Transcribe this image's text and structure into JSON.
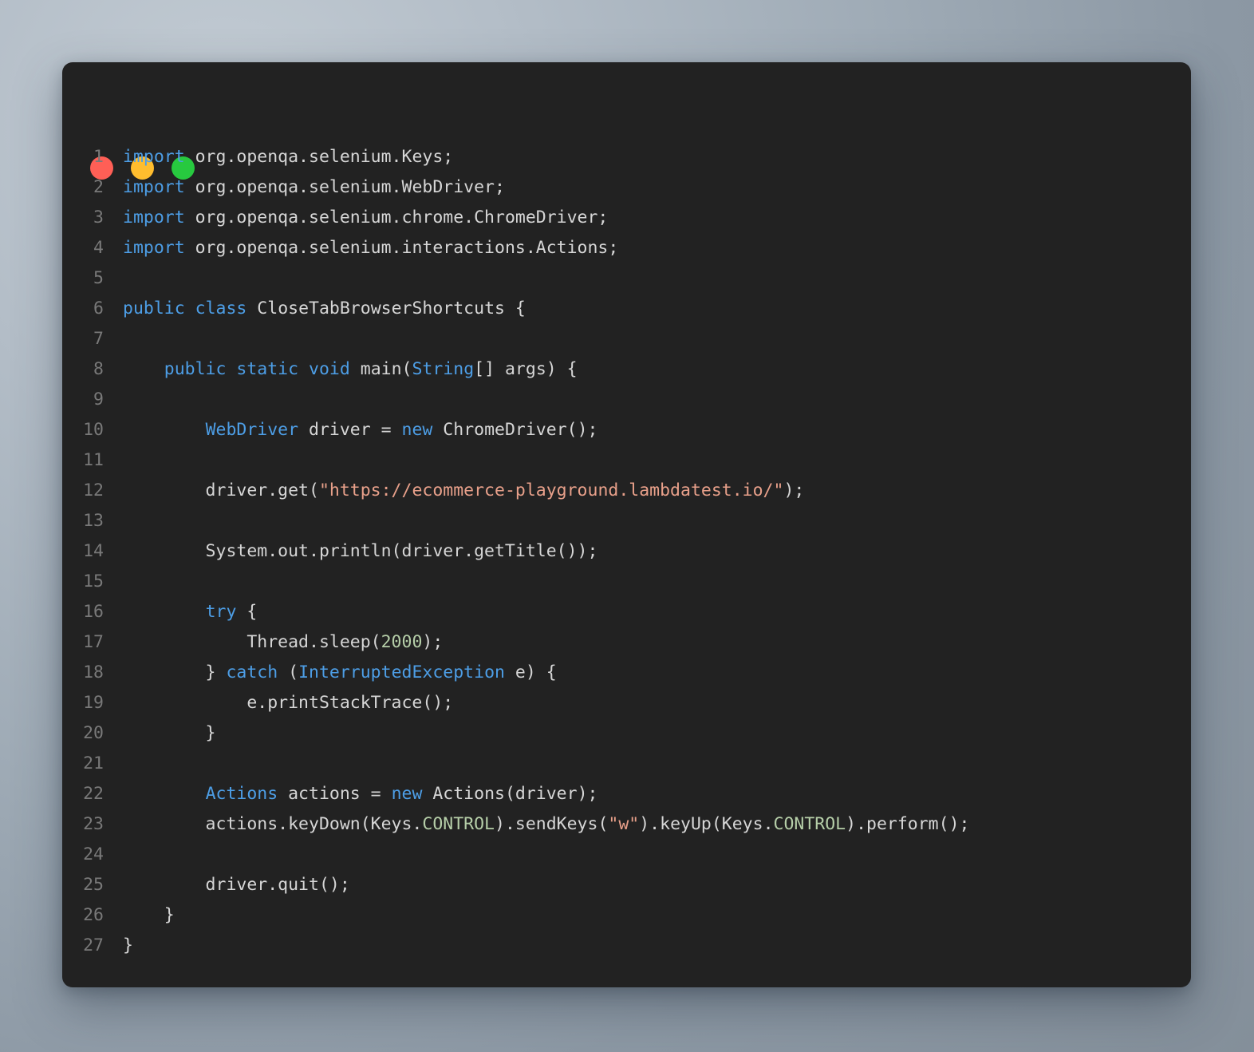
{
  "window": {
    "background_color": "#222222",
    "page_background_color": "#9aa6b1",
    "traffic_lights": [
      {
        "name": "close",
        "color": "#ff5f56"
      },
      {
        "name": "minimize",
        "color": "#ffbd2e"
      },
      {
        "name": "maximize",
        "color": "#27c93f"
      }
    ]
  },
  "editor": {
    "language": "java",
    "theme_colors": {
      "keyword": "#4d9ee6",
      "type": "#4d9ee6",
      "string": "#e8a08a",
      "number": "#b5cea8",
      "constant": "#b5cea8",
      "plain": "#d6d6d6",
      "line_number": "#797979"
    },
    "lines": [
      {
        "n": "1",
        "tokens": [
          {
            "t": "import",
            "c": "kw"
          },
          {
            "t": " org.openqa.selenium.Keys;",
            "c": "plain"
          }
        ]
      },
      {
        "n": "2",
        "tokens": [
          {
            "t": "import",
            "c": "kw"
          },
          {
            "t": " org.openqa.selenium.WebDriver;",
            "c": "plain"
          }
        ]
      },
      {
        "n": "3",
        "tokens": [
          {
            "t": "import",
            "c": "kw"
          },
          {
            "t": " org.openqa.selenium.chrome.ChromeDriver;",
            "c": "plain"
          }
        ]
      },
      {
        "n": "4",
        "tokens": [
          {
            "t": "import",
            "c": "kw"
          },
          {
            "t": " org.openqa.selenium.interactions.Actions;",
            "c": "plain"
          }
        ]
      },
      {
        "n": "5",
        "tokens": []
      },
      {
        "n": "6",
        "tokens": [
          {
            "t": "public",
            "c": "kw"
          },
          {
            "t": " ",
            "c": "plain"
          },
          {
            "t": "class",
            "c": "kw"
          },
          {
            "t": " CloseTabBrowserShortcuts {",
            "c": "plain"
          }
        ]
      },
      {
        "n": "7",
        "tokens": []
      },
      {
        "n": "8",
        "tokens": [
          {
            "t": "    ",
            "c": "plain"
          },
          {
            "t": "public",
            "c": "kw"
          },
          {
            "t": " ",
            "c": "plain"
          },
          {
            "t": "static",
            "c": "kw"
          },
          {
            "t": " ",
            "c": "plain"
          },
          {
            "t": "void",
            "c": "kw"
          },
          {
            "t": " main(",
            "c": "plain"
          },
          {
            "t": "String",
            "c": "type"
          },
          {
            "t": "[] args) {",
            "c": "plain"
          }
        ]
      },
      {
        "n": "9",
        "tokens": []
      },
      {
        "n": "10",
        "tokens": [
          {
            "t": "        ",
            "c": "plain"
          },
          {
            "t": "WebDriver",
            "c": "type"
          },
          {
            "t": " driver = ",
            "c": "plain"
          },
          {
            "t": "new",
            "c": "kw"
          },
          {
            "t": " ChromeDriver();",
            "c": "plain"
          }
        ]
      },
      {
        "n": "11",
        "tokens": []
      },
      {
        "n": "12",
        "tokens": [
          {
            "t": "        driver.get(",
            "c": "plain"
          },
          {
            "t": "\"https://ecommerce-playground.lambdatest.io/\"",
            "c": "str"
          },
          {
            "t": ");",
            "c": "plain"
          }
        ]
      },
      {
        "n": "13",
        "tokens": []
      },
      {
        "n": "14",
        "tokens": [
          {
            "t": "        System.out.println(driver.getTitle());",
            "c": "plain"
          }
        ]
      },
      {
        "n": "15",
        "tokens": []
      },
      {
        "n": "16",
        "tokens": [
          {
            "t": "        ",
            "c": "plain"
          },
          {
            "t": "try",
            "c": "kw"
          },
          {
            "t": " {",
            "c": "plain"
          }
        ]
      },
      {
        "n": "17",
        "tokens": [
          {
            "t": "            Thread.sleep(",
            "c": "plain"
          },
          {
            "t": "2000",
            "c": "num"
          },
          {
            "t": ");",
            "c": "plain"
          }
        ]
      },
      {
        "n": "18",
        "tokens": [
          {
            "t": "        } ",
            "c": "plain"
          },
          {
            "t": "catch",
            "c": "kw"
          },
          {
            "t": " (",
            "c": "plain"
          },
          {
            "t": "InterruptedException",
            "c": "type"
          },
          {
            "t": " e) {",
            "c": "plain"
          }
        ]
      },
      {
        "n": "19",
        "tokens": [
          {
            "t": "            e.printStackTrace();",
            "c": "plain"
          }
        ]
      },
      {
        "n": "20",
        "tokens": [
          {
            "t": "        }",
            "c": "plain"
          }
        ]
      },
      {
        "n": "21",
        "tokens": []
      },
      {
        "n": "22",
        "tokens": [
          {
            "t": "        ",
            "c": "plain"
          },
          {
            "t": "Actions",
            "c": "type"
          },
          {
            "t": " actions = ",
            "c": "plain"
          },
          {
            "t": "new",
            "c": "kw"
          },
          {
            "t": " Actions(driver);",
            "c": "plain"
          }
        ]
      },
      {
        "n": "23",
        "tokens": [
          {
            "t": "        actions.keyDown(Keys.",
            "c": "plain"
          },
          {
            "t": "CONTROL",
            "c": "const"
          },
          {
            "t": ").sendKeys(",
            "c": "plain"
          },
          {
            "t": "\"w\"",
            "c": "str"
          },
          {
            "t": ").keyUp(Keys.",
            "c": "plain"
          },
          {
            "t": "CONTROL",
            "c": "const"
          },
          {
            "t": ").perform();",
            "c": "plain"
          }
        ]
      },
      {
        "n": "24",
        "tokens": []
      },
      {
        "n": "25",
        "tokens": [
          {
            "t": "        driver.quit();",
            "c": "plain"
          }
        ]
      },
      {
        "n": "26",
        "tokens": [
          {
            "t": "    }",
            "c": "plain"
          }
        ]
      },
      {
        "n": "27",
        "tokens": [
          {
            "t": "}",
            "c": "plain"
          }
        ]
      }
    ]
  }
}
